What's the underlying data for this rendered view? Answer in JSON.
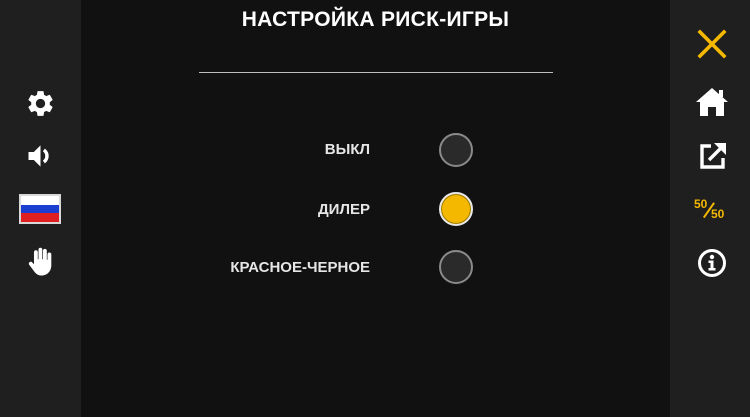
{
  "title": "НАСТРОЙКА РИСК-ИГРЫ",
  "options": [
    {
      "label": "ВЫКЛ",
      "selected": false
    },
    {
      "label": "ДИЛЕР",
      "selected": true
    },
    {
      "label": "КРАСНОЕ-ЧЕРНОЕ",
      "selected": false
    }
  ],
  "left_sidebar": {
    "icons": [
      "gear-icon",
      "speaker-icon",
      "russian-flag-icon",
      "hand-icon"
    ]
  },
  "right_sidebar": {
    "icons": [
      "close-icon",
      "home-icon",
      "share-icon",
      "fifty-fifty-icon",
      "info-icon"
    ],
    "fifty_top": "50",
    "fifty_bottom": "50"
  },
  "colors": {
    "accent": "#f5b800",
    "background": "#111111",
    "sidebar": "#1f1f1f",
    "text": "#ffffff",
    "flag_white": "#ffffff",
    "flag_blue": "#1a3fd0",
    "flag_red": "#e02020"
  }
}
